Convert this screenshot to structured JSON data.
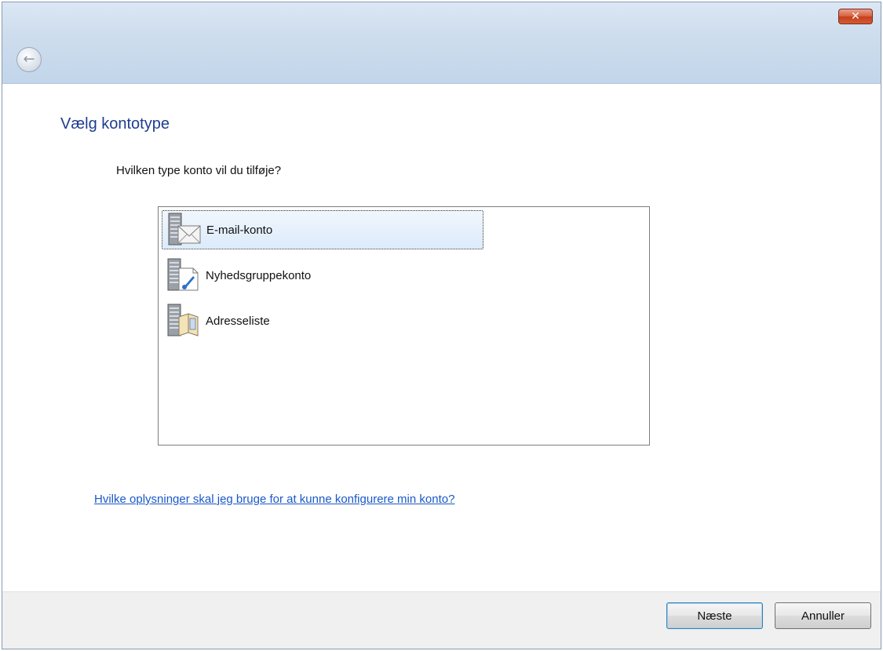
{
  "window": {
    "close_label": "✕",
    "back_icon": "back-arrow-icon"
  },
  "main": {
    "title": "Vælg kontotype",
    "question": "Hvilken type konto vil du tilføje?",
    "account_types": [
      {
        "label": "E-mail-konto",
        "icon": "mail-server-icon",
        "selected": true
      },
      {
        "label": "Nyhedsgruppekonto",
        "icon": "newsgroup-server-icon",
        "selected": false
      },
      {
        "label": "Adresseliste",
        "icon": "directory-server-icon",
        "selected": false
      }
    ],
    "help_link": "Hvilke oplysninger skal jeg bruge for at kunne konfigurere min konto?"
  },
  "footer": {
    "next_label": "Næste",
    "cancel_label": "Annuller"
  },
  "colors": {
    "title_blue": "#1e3d8f",
    "link_blue": "#1a58c7",
    "close_red": "#c4401c"
  }
}
